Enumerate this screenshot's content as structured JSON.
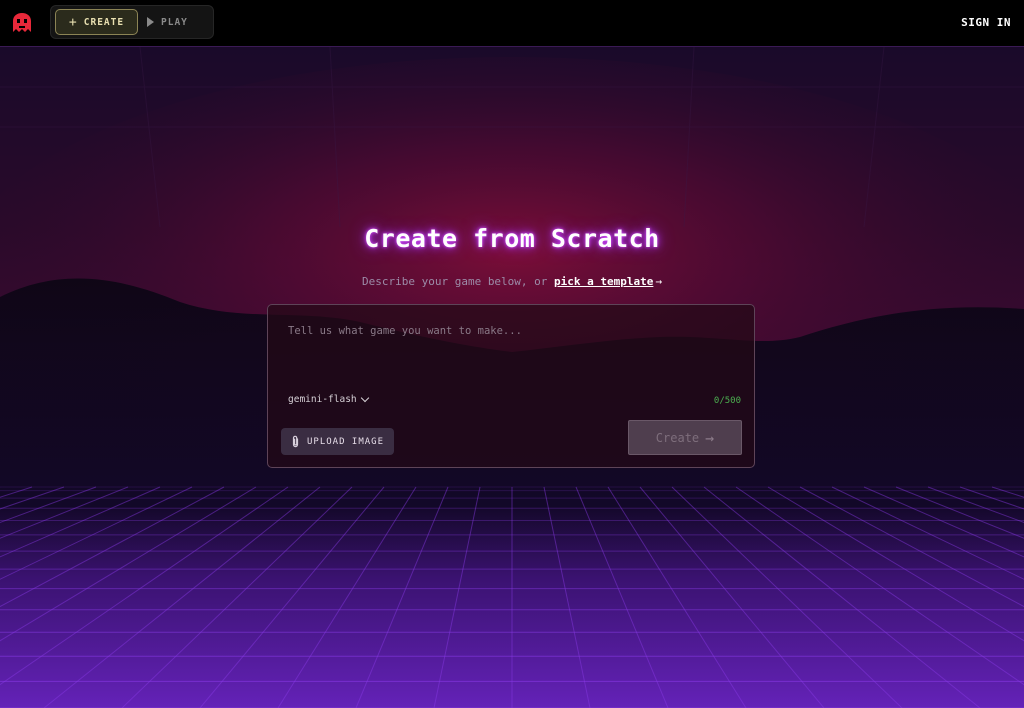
{
  "topbar": {
    "logo_icon": "arcade-ghost-logo-icon",
    "create_label": "CREATE",
    "play_label": "PLAY",
    "sign_in_label": "SIGN IN"
  },
  "hero": {
    "title": "Create from Scratch",
    "subtitle_prefix": "Describe your game below, or",
    "template_link": "pick a template",
    "arrow": "→"
  },
  "form": {
    "prompt_placeholder": "Tell us what game you want to make...",
    "prompt_value": "",
    "model": "gemini-flash",
    "char_count": "0/500",
    "upload_label": "UPLOAD IMAGE",
    "create_label": "Create",
    "create_arrow": "→"
  },
  "colors": {
    "accent_glow": "#b23cff",
    "char_count": "#4caf50",
    "grid_line": "#8a3ae6"
  }
}
